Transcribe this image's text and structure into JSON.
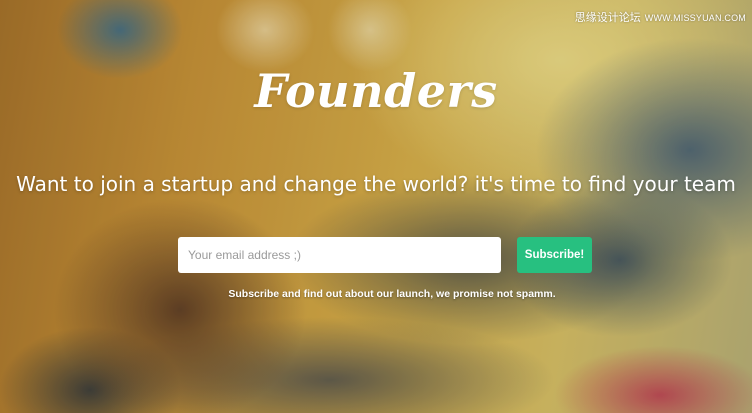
{
  "watermark": {
    "text": "思缘设计论坛",
    "site": "WWW.MISSYUAN.COM"
  },
  "hero": {
    "logo": "Founders",
    "tagline": "Want to join a startup and change the world? it's time to find your team",
    "note": "Subscribe and find out about our launch, we promise not spamm."
  },
  "form": {
    "email_placeholder": "Your email address ;)",
    "email_value": "",
    "subscribe_label": "Subscribe!"
  },
  "colors": {
    "accent": "#27c080",
    "text": "#ffffff"
  }
}
